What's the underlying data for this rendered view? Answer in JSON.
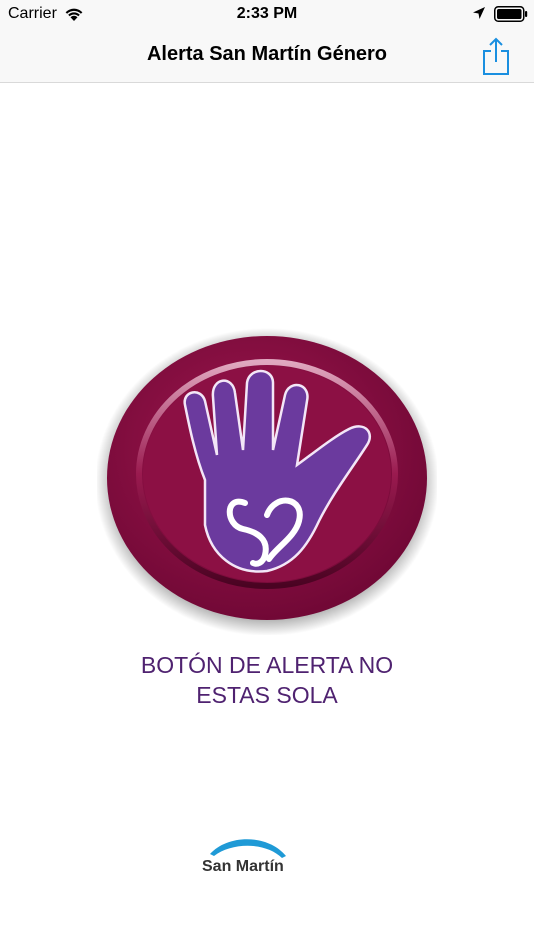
{
  "status_bar": {
    "carrier": "Carrier",
    "time": "2:33 PM"
  },
  "nav_bar": {
    "title": "Alerta San Martín Género",
    "share_icon": "share-icon",
    "accent_color": "#1a8fe0"
  },
  "main": {
    "alert_button_icon": "hand-heart-icon",
    "alert_label_line1": "BOTÓN DE ALERTA NO",
    "alert_label_line2": "ESTAS SOLA",
    "label_color": "#4f2270",
    "button_color": "#7d0a3e",
    "hand_color": "#6b3a9e"
  },
  "footer": {
    "logo_text": "San Martín",
    "logo_arc_color": "#1f9ad6"
  }
}
